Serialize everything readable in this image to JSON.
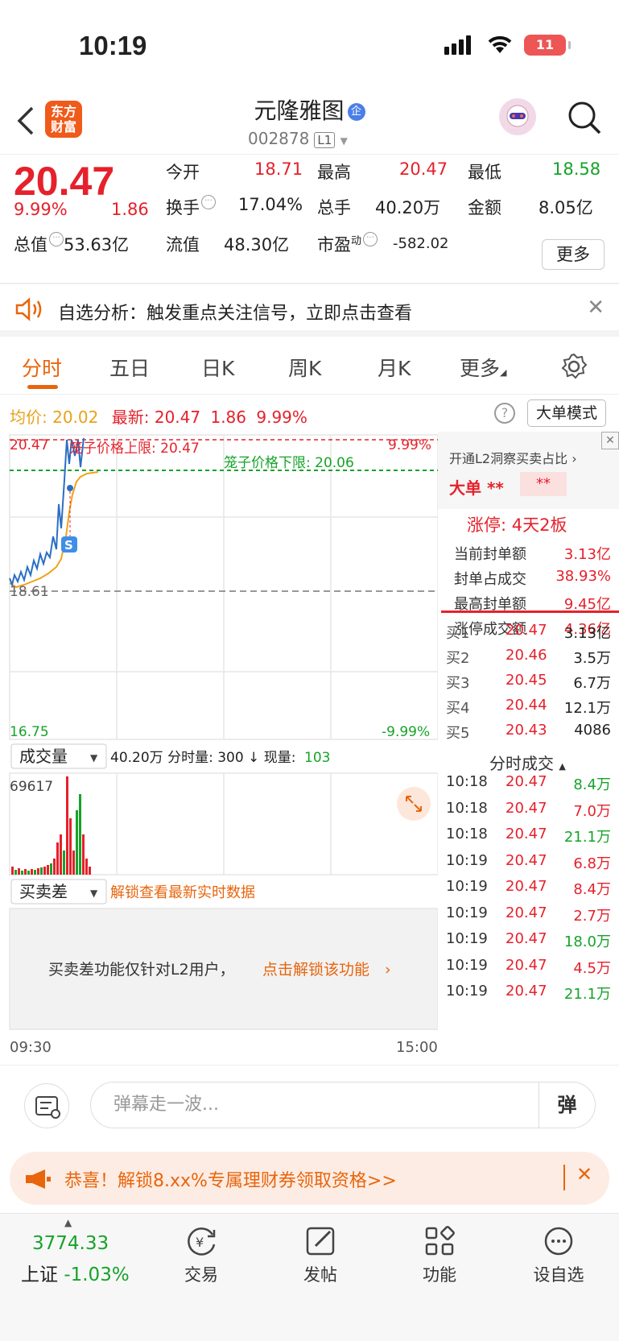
{
  "status": {
    "time": "10:19",
    "battery": "11"
  },
  "header": {
    "logo_line1": "东方",
    "logo_line2": "财富",
    "name": "元隆雅图",
    "badge": "企",
    "code": "002878",
    "level": "L1"
  },
  "quote": {
    "price": "20.47",
    "pct": "9.99%",
    "chg": "1.86",
    "open_label": "今开",
    "open": "18.71",
    "high_label": "最高",
    "high": "20.47",
    "low_label": "最低",
    "low": "18.58",
    "turnover_label": "换手",
    "turnover": "17.04%",
    "vol_label": "总手",
    "vol": "40.20万",
    "amount_label": "金额",
    "amount": "8.05亿",
    "mcap_label": "总值",
    "mcap": "53.63亿",
    "float_label": "流值",
    "float": "48.30亿",
    "pe_label": "市盈",
    "pe_sup": "动",
    "pe": "-582.02",
    "more": "更多"
  },
  "notice": {
    "text": "自选分析：触发重点关注信号，立即点击查看"
  },
  "tabs": [
    "分时",
    "五日",
    "日K",
    "周K",
    "月K",
    "更多"
  ],
  "avgbar": {
    "avg_label": "均价:",
    "avg": "20.02",
    "latest_label": "最新:",
    "latest": "20.47",
    "chg": "1.86",
    "pct": "9.99%",
    "mode": "大单模式"
  },
  "chart": {
    "top_left": "20.47",
    "top_right": "9.99%",
    "bottom_left": "16.75",
    "bottom_right": "-9.99%",
    "mid": "18.61",
    "upper_cage": "笼子价格上限: 20.47",
    "lower_cage": "笼子价格下限: 20.06",
    "start": "09:30",
    "end": "15:00",
    "vol_select": "成交量",
    "vol_info": "40.20万 分时量: 300 ↓ 现量:",
    "vol_now": "103",
    "vol_max": "69617",
    "spread_select": "买卖差",
    "spread_link": "解锁查看最新实时数据",
    "spread_msg": "买卖差功能仅针对L2用户，",
    "spread_cta": "点击解锁该功能"
  },
  "chart_data": {
    "type": "line",
    "title": "",
    "x_range": [
      "09:30",
      "15:00"
    ],
    "ylim": [
      16.75,
      20.47
    ],
    "prev_close": 18.61,
    "series": [],
    "volume_max": 69617
  },
  "rpanel": {
    "l2": "开通L2洞察买卖占比",
    "big_label": "大单",
    "big_val": "**",
    "big_val2": "**",
    "limit": "涨停: 4天2板",
    "stats": [
      {
        "k": "当前封单额",
        "v": "3.13亿"
      },
      {
        "k": "封单占成交",
        "v": "38.93%"
      },
      {
        "k": "最高封单额",
        "v": "9.45亿"
      },
      {
        "k": "涨停成交额",
        "v": "4.36亿"
      }
    ],
    "bids": [
      {
        "k": "买1",
        "p": "20.47",
        "v": "3.13亿"
      },
      {
        "k": "买2",
        "p": "20.46",
        "v": "3.5万"
      },
      {
        "k": "买3",
        "p": "20.45",
        "v": "6.7万"
      },
      {
        "k": "买4",
        "p": "20.44",
        "v": "12.1万"
      },
      {
        "k": "买5",
        "p": "20.43",
        "v": "4086"
      }
    ],
    "ticks_title": "分时成交",
    "ticks": [
      {
        "t": "10:18",
        "p": "20.47",
        "v": "8.4万",
        "c": "g"
      },
      {
        "t": "10:18",
        "p": "20.47",
        "v": "7.0万",
        "c": "r"
      },
      {
        "t": "10:18",
        "p": "20.47",
        "v": "21.1万",
        "c": "g"
      },
      {
        "t": "10:19",
        "p": "20.47",
        "v": "6.8万",
        "c": "r"
      },
      {
        "t": "10:19",
        "p": "20.47",
        "v": "8.4万",
        "c": "r"
      },
      {
        "t": "10:19",
        "p": "20.47",
        "v": "2.7万",
        "c": "r"
      },
      {
        "t": "10:19",
        "p": "20.47",
        "v": "18.0万",
        "c": "g"
      },
      {
        "t": "10:19",
        "p": "20.47",
        "v": "4.5万",
        "c": "r"
      },
      {
        "t": "10:19",
        "p": "20.47",
        "v": "21.1万",
        "c": "g"
      }
    ]
  },
  "bottom": {
    "danmu_placeholder": "弹幕走一波...",
    "danmu_btn": "弹"
  },
  "promo": {
    "text": "恭喜！解锁8.xx%专属理财券领取资格>>"
  },
  "tabbar": {
    "index_val": "3774.33",
    "index_name": "上证",
    "index_pct": "-1.03%",
    "items": [
      "交易",
      "发帖",
      "功能",
      "设自选"
    ]
  }
}
